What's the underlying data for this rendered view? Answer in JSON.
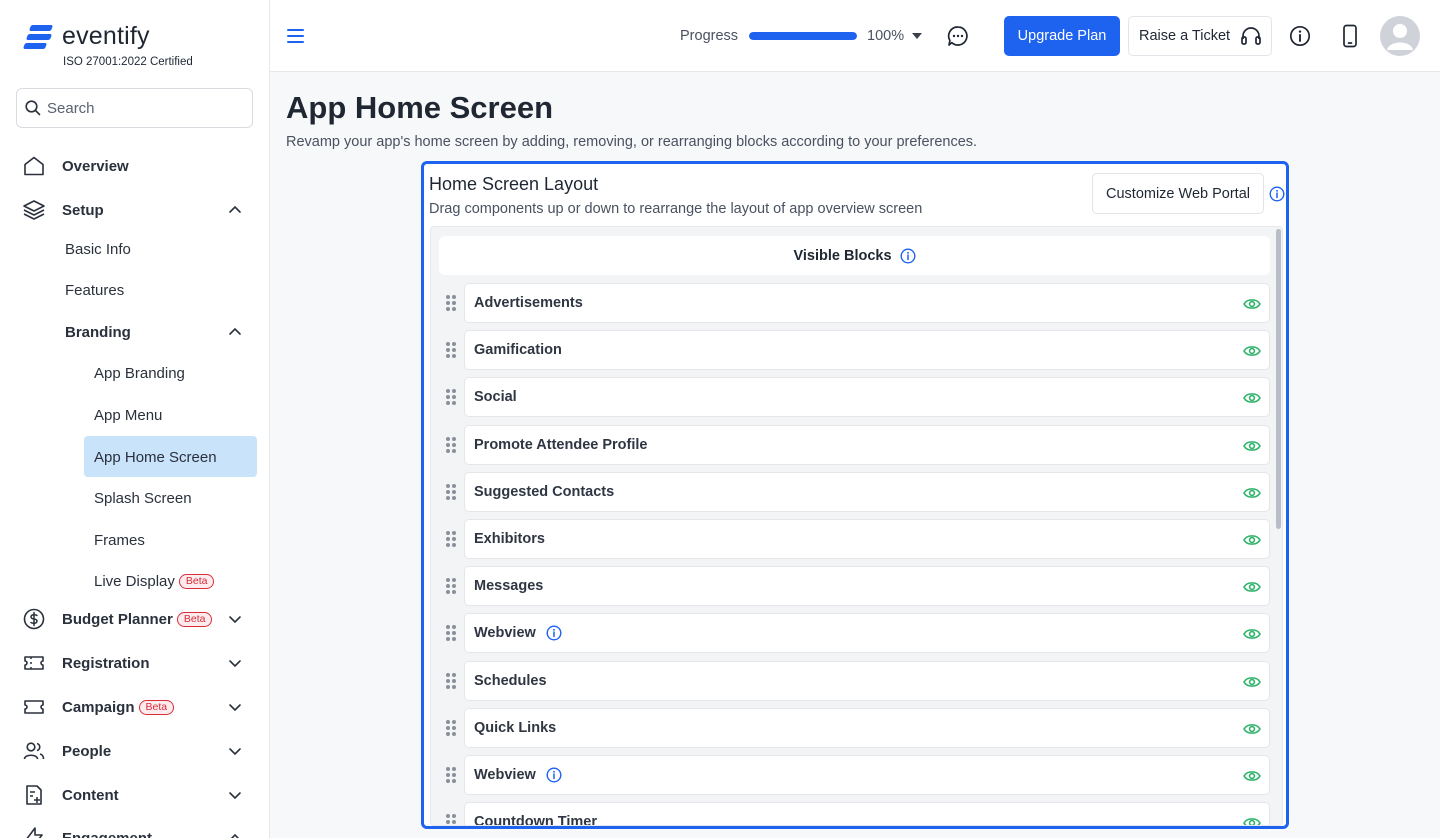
{
  "app": {
    "logo_text": "eventify",
    "certification": "ISO 27001:2022 Certified",
    "brand_color": "#1e62f0"
  },
  "search": {
    "placeholder": "Search"
  },
  "sidebar": {
    "overview": "Overview",
    "setup": "Setup",
    "setup_items": {
      "basic_info": "Basic Info",
      "features": "Features",
      "branding": "Branding"
    },
    "branding_items": {
      "app_branding": "App Branding",
      "app_menu": "App Menu",
      "app_home_screen": "App Home Screen",
      "splash_screen": "Splash Screen",
      "frames": "Frames",
      "live_display": "Live Display"
    },
    "beta_label": "Beta",
    "budget_planner": "Budget Planner",
    "registration": "Registration",
    "campaign": "Campaign",
    "people": "People",
    "content": "Content",
    "engagement": "Engagement"
  },
  "topbar": {
    "progress_label": "Progress",
    "progress_value": 100,
    "progress_text": "100%",
    "upgrade_label": "Upgrade Plan",
    "ticket_label": "Raise a Ticket"
  },
  "page": {
    "title": "App Home Screen",
    "description": "Revamp your app's home screen by adding, removing, or rearranging blocks according to your preferences."
  },
  "layout_panel": {
    "title": "Home Screen Layout",
    "subtitle": "Drag components up or down to rearrange the layout of app overview screen",
    "portal_button": "Customize Web Portal",
    "visible_blocks_label": "Visible Blocks",
    "blocks": [
      {
        "label": "Advertisements",
        "info": false
      },
      {
        "label": "Gamification",
        "info": false
      },
      {
        "label": "Social",
        "info": false
      },
      {
        "label": "Promote Attendee Profile",
        "info": false
      },
      {
        "label": "Suggested Contacts",
        "info": false
      },
      {
        "label": "Exhibitors",
        "info": false
      },
      {
        "label": "Messages",
        "info": false
      },
      {
        "label": "Webview",
        "info": true
      },
      {
        "label": "Schedules",
        "info": false
      },
      {
        "label": "Quick Links",
        "info": false
      },
      {
        "label": "Webview",
        "info": true
      },
      {
        "label": "Countdown Timer",
        "info": false
      }
    ],
    "eye_color": "#2fb36b"
  }
}
